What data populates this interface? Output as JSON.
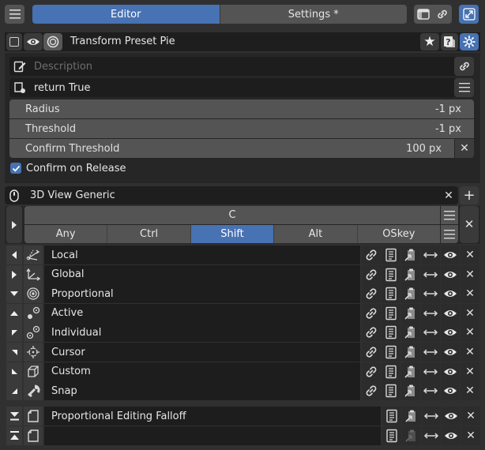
{
  "header": {
    "tab_editor": "Editor",
    "tab_settings": "Settings *",
    "active_tab": "Editor",
    "menu_icon": "hamburger-menu-icon",
    "right_icons": [
      "window-icon",
      "link-icon",
      "maximize-icon"
    ]
  },
  "item": {
    "name": "Transform Preset Pie",
    "checkbox_checked": false,
    "icons": [
      "eye-icon",
      "pie-menu-icon",
      "star-icon",
      "help-icon",
      "settings-gear-icon"
    ]
  },
  "description": {
    "placeholder": "Description",
    "value": ""
  },
  "poll": {
    "value": "return True"
  },
  "properties": [
    {
      "label": "Radius",
      "value": "-1 px"
    },
    {
      "label": "Threshold",
      "value": "-1 px"
    },
    {
      "label": "Confirm Threshold",
      "value": "100 px"
    }
  ],
  "confirm_on_release": {
    "label": "Confirm on Release",
    "checked": true
  },
  "keymap": {
    "name": "3D View Generic",
    "key": "C",
    "modifiers": [
      "Any",
      "Ctrl",
      "Shift",
      "Alt",
      "OSkey"
    ],
    "active_modifier": "Shift"
  },
  "pie_items": [
    {
      "label": "Local",
      "direction_icon": "left-arrow-icon",
      "icon": "local-axes-icon"
    },
    {
      "label": "Global",
      "direction_icon": "right-arrow-icon",
      "icon": "global-axes-icon"
    },
    {
      "label": "Proportional",
      "direction_icon": "down-arrow-icon",
      "icon": "proportional-icon"
    },
    {
      "label": "Active",
      "direction_icon": "up-arrow-icon",
      "icon": "active-pivot-icon"
    },
    {
      "label": "Individual",
      "direction_icon": "up-left-arrow-icon",
      "icon": "individual-origins-icon"
    },
    {
      "label": "Cursor",
      "direction_icon": "up-right-arrow-icon",
      "icon": "cursor-icon"
    },
    {
      "label": "Custom",
      "direction_icon": "down-left-arrow-icon",
      "icon": "custom-icon"
    },
    {
      "label": "Snap",
      "direction_icon": "down-right-arrow-icon",
      "icon": "snap-magnet-icon"
    }
  ],
  "extra_items": [
    {
      "label": "Proportional Editing Falloff",
      "direction_icon": "bottom-icon",
      "icon": "menu-icon"
    },
    {
      "label": "",
      "direction_icon": "top-icon",
      "icon": "menu-icon"
    }
  ],
  "colors": {
    "background": "#303030",
    "accent": "#4772b3",
    "button": "#545454",
    "field": "#1d1d1d"
  }
}
